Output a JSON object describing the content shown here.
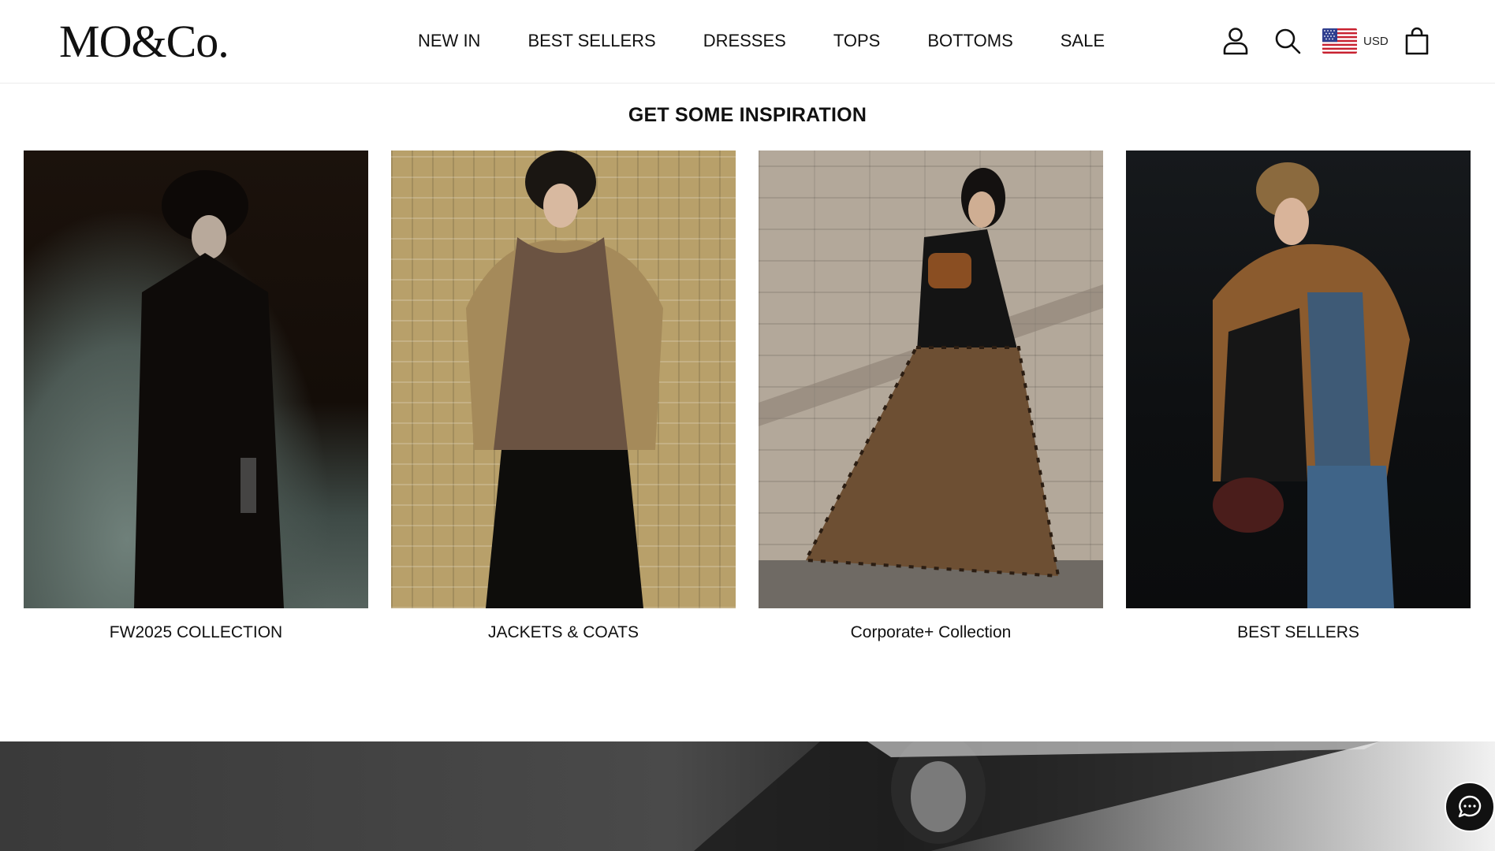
{
  "brand": {
    "logo_text": "MO&Co."
  },
  "nav": {
    "items": [
      "NEW IN",
      "BEST SELLERS",
      "DRESSES",
      "TOPS",
      "BOTTOMS",
      "SALE"
    ]
  },
  "header": {
    "icons": [
      "account-icon",
      "search-icon",
      "us-flag-icon",
      "cart-icon"
    ],
    "currency": "USD"
  },
  "inspiration": {
    "title": "GET SOME INSPIRATION",
    "cards": [
      {
        "caption": "FW2025 COLLECTION"
      },
      {
        "caption": "JACKETS & COATS"
      },
      {
        "caption": "Corporate+ Collection"
      },
      {
        "caption": "BEST SELLERS"
      }
    ]
  },
  "chat": {
    "icon": "chat-bubble-icon"
  },
  "colors": {
    "text": "#111111",
    "header_border": "#ececec",
    "chat_bg": "#111111"
  }
}
